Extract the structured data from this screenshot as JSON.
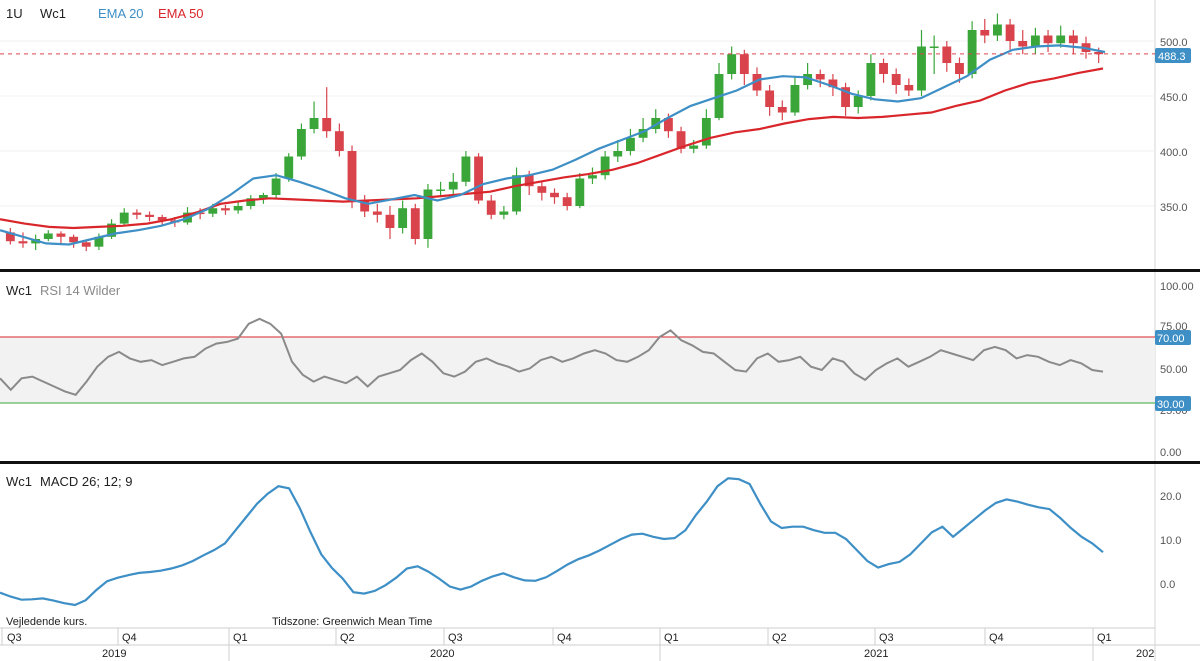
{
  "top_panel": {
    "interval": "1U",
    "symbol": "Wc1",
    "ema20_label": "EMA 20",
    "ema50_label": "EMA 50",
    "last_price": "488.3",
    "y_ticks": [
      "500.0",
      "450.0",
      "400.0",
      "350.0"
    ]
  },
  "rsi_panel": {
    "symbol": "Wc1",
    "label": "RSI 14 Wilder",
    "y_ticks": [
      "100.00",
      "75.00",
      "50.00",
      "25.00",
      "0.00"
    ],
    "upper_badge": "70.00",
    "lower_badge": "30.00"
  },
  "macd_panel": {
    "symbol": "Wc1",
    "label": "MACD 26; 12; 9",
    "y_ticks": [
      "20.0",
      "10.0",
      "0.0"
    ]
  },
  "footer": {
    "note": "Vejledende kurs.",
    "timezone": "Tidszone: Greenwich Mean Time",
    "quarters": [
      "Q3",
      "Q4",
      "Q1",
      "Q2",
      "Q3",
      "Q4",
      "Q1",
      "Q2",
      "Q3",
      "Q4",
      "Q1"
    ],
    "years": [
      "2019",
      "2020",
      "2021",
      "202"
    ]
  },
  "colors": {
    "ema20": "#3d8fc6",
    "ema50": "#d9262b",
    "up": "#3aa63a",
    "down": "#d9434b",
    "rsi": "#8a8a8a",
    "macd": "#3d8fc6",
    "badge": "#3d8fc6"
  },
  "chart_data": [
    {
      "type": "line",
      "panel": "price",
      "x_quarters": [
        "Q3 2019",
        "Q4 2019",
        "Q1 2020",
        "Q2 2020",
        "Q3 2020",
        "Q4 2020",
        "Q1 2021",
        "Q2 2021",
        "Q3 2021",
        "Q4 2021",
        "Q1 2022"
      ],
      "ylim": [
        310,
        525
      ],
      "last": 488.3,
      "ema20": [
        328,
        322,
        316,
        315,
        320,
        325,
        328,
        332,
        338,
        347,
        360,
        375,
        378,
        372,
        365,
        357,
        352,
        356,
        360,
        355,
        360,
        370,
        375,
        378,
        383,
        392,
        402,
        410,
        418,
        430,
        441,
        448,
        455,
        465,
        468,
        467,
        460,
        452,
        447,
        445,
        448,
        458,
        468,
        483,
        492,
        495,
        496,
        494,
        490
      ],
      "ema50": [
        338,
        334,
        331,
        330,
        331,
        332,
        334,
        338,
        344,
        352,
        355,
        357,
        356,
        355,
        354,
        355,
        356,
        357,
        359,
        361,
        363,
        368,
        372,
        376,
        379,
        383,
        389,
        397,
        405,
        412,
        417,
        420,
        425,
        429,
        431,
        430,
        431,
        433,
        435,
        441,
        446,
        455,
        462,
        466,
        471,
        475
      ],
      "candles": [
        [
          326,
          318,
          330,
          315
        ],
        [
          318,
          316,
          326,
          312
        ],
        [
          316,
          320,
          324,
          310
        ],
        [
          320,
          325,
          328,
          318
        ],
        [
          325,
          322,
          327,
          316
        ],
        [
          322,
          317,
          324,
          312
        ],
        [
          317,
          313,
          319,
          309
        ],
        [
          313,
          322,
          325,
          310
        ],
        [
          322,
          334,
          338,
          320
        ],
        [
          334,
          344,
          348,
          332
        ],
        [
          344,
          342,
          347,
          338
        ],
        [
          342,
          340,
          345,
          336
        ],
        [
          340,
          337,
          342,
          333
        ],
        [
          337,
          335,
          340,
          331
        ],
        [
          335,
          344,
          349,
          333
        ],
        [
          344,
          343,
          348,
          338
        ],
        [
          343,
          348,
          352,
          340
        ],
        [
          348,
          346,
          351,
          342
        ],
        [
          346,
          350,
          355,
          343
        ],
        [
          350,
          357,
          360,
          347
        ],
        [
          357,
          360,
          362,
          352
        ],
        [
          360,
          375,
          380,
          357
        ],
        [
          375,
          395,
          398,
          372
        ],
        [
          395,
          420,
          425,
          392
        ],
        [
          420,
          430,
          445,
          416
        ],
        [
          430,
          418,
          458,
          412
        ],
        [
          418,
          400,
          425,
          395
        ],
        [
          400,
          355,
          405,
          348
        ],
        [
          355,
          345,
          360,
          340
        ],
        [
          345,
          342,
          352,
          335
        ],
        [
          342,
          330,
          350,
          320
        ],
        [
          330,
          348,
          355,
          325
        ],
        [
          348,
          320,
          352,
          315
        ],
        [
          320,
          365,
          370,
          312
        ],
        [
          365,
          365,
          372,
          358
        ],
        [
          365,
          372,
          380,
          360
        ],
        [
          372,
          395,
          400,
          368
        ],
        [
          395,
          355,
          398,
          352
        ],
        [
          355,
          342,
          360,
          338
        ],
        [
          342,
          345,
          350,
          338
        ],
        [
          345,
          378,
          385,
          342
        ],
        [
          378,
          368,
          382,
          360
        ],
        [
          368,
          362,
          372,
          355
        ],
        [
          362,
          358,
          366,
          352
        ],
        [
          358,
          350,
          362,
          346
        ],
        [
          350,
          375,
          380,
          348
        ],
        [
          375,
          378,
          385,
          370
        ],
        [
          378,
          395,
          400,
          374
        ],
        [
          395,
          400,
          410,
          390
        ],
        [
          400,
          412,
          420,
          396
        ],
        [
          412,
          420,
          430,
          408
        ],
        [
          420,
          430,
          438,
          416
        ],
        [
          430,
          418,
          434,
          412
        ],
        [
          418,
          402,
          422,
          398
        ],
        [
          402,
          405,
          410,
          398
        ],
        [
          405,
          430,
          438,
          402
        ],
        [
          430,
          470,
          480,
          428
        ],
        [
          470,
          488,
          495,
          465
        ],
        [
          488,
          470,
          492,
          460
        ],
        [
          470,
          455,
          476,
          450
        ],
        [
          455,
          440,
          460,
          432
        ],
        [
          440,
          435,
          446,
          428
        ],
        [
          435,
          460,
          468,
          432
        ],
        [
          460,
          470,
          480,
          456
        ],
        [
          470,
          465,
          474,
          458
        ],
        [
          465,
          458,
          470,
          450
        ],
        [
          458,
          440,
          462,
          432
        ],
        [
          440,
          450,
          455,
          434
        ],
        [
          450,
          480,
          488,
          446
        ],
        [
          480,
          470,
          484,
          462
        ],
        [
          470,
          460,
          475,
          452
        ],
        [
          460,
          455,
          466,
          450
        ],
        [
          455,
          495,
          510,
          450
        ],
        [
          495,
          495,
          505,
          470
        ],
        [
          495,
          480,
          500,
          472
        ],
        [
          480,
          470,
          485,
          462
        ],
        [
          470,
          510,
          518,
          466
        ],
        [
          510,
          505,
          520,
          498
        ],
        [
          505,
          515,
          525,
          500
        ],
        [
          515,
          500,
          520,
          490
        ],
        [
          500,
          495,
          510,
          488
        ],
        [
          495,
          505,
          512,
          488
        ],
        [
          505,
          498,
          510,
          490
        ],
        [
          498,
          505,
          514,
          494
        ],
        [
          505,
          498,
          510,
          488
        ],
        [
          498,
          490,
          504,
          484
        ],
        [
          490,
          488,
          494,
          480
        ]
      ]
    },
    {
      "type": "line",
      "panel": "rsi",
      "title": "RSI 14 Wilder",
      "ylim": [
        0,
        100
      ],
      "levels": [
        70,
        30
      ],
      "values": [
        45,
        38,
        45,
        46,
        43,
        40,
        37,
        35,
        43,
        52,
        58,
        61,
        57,
        55,
        56,
        53,
        55,
        57,
        58,
        63,
        66,
        67,
        69,
        78,
        81,
        78,
        72,
        55,
        47,
        43,
        46,
        44,
        42,
        46,
        40,
        46,
        48,
        50,
        56,
        60,
        55,
        48,
        46,
        49,
        55,
        57,
        54,
        52,
        49,
        51,
        56,
        58,
        55,
        57,
        60,
        62,
        60,
        56,
        55,
        58,
        62,
        70,
        74,
        68,
        65,
        61,
        60,
        55,
        50,
        49,
        57,
        60,
        55,
        56,
        58,
        52,
        50,
        57,
        55,
        48,
        44,
        50,
        54,
        57,
        52,
        55,
        58,
        62,
        60,
        58,
        56,
        62,
        64,
        62,
        57,
        59,
        58,
        55,
        53,
        56,
        54,
        50,
        49
      ]
    },
    {
      "type": "line",
      "panel": "macd",
      "title": "MACD 26; 12; 9",
      "ylim": [
        -5,
        25
      ],
      "values": [
        -2.2,
        -3.1,
        -3.8,
        -3.7,
        -3.5,
        -4.0,
        -4.6,
        -5.0,
        -3.9,
        -1.6,
        0.4,
        1.2,
        1.8,
        2.3,
        2.5,
        2.8,
        3.3,
        4.0,
        5.0,
        6.3,
        7.5,
        9.0,
        12.0,
        15.0,
        18.0,
        20.3,
        22.0,
        21.5,
        17.0,
        11.5,
        6.5,
        3.4,
        1.0,
        -2.1,
        -2.4,
        -1.8,
        -0.5,
        1.2,
        3.3,
        3.8,
        2.6,
        1.0,
        -0.8,
        -1.5,
        -0.8,
        0.5,
        1.5,
        2.2,
        1.3,
        0.6,
        0.5,
        1.3,
        2.7,
        4.2,
        5.4,
        6.3,
        7.4,
        8.7,
        10.0,
        11.0,
        11.2,
        10.5,
        10.0,
        10.2,
        12.0,
        15.5,
        18.5,
        22.0,
        23.8,
        23.6,
        22.5,
        18.0,
        14.0,
        12.5,
        12.8,
        12.8,
        12.0,
        11.4,
        11.4,
        10.0,
        7.5,
        5.0,
        3.5,
        4.3,
        4.8,
        6.5,
        9.0,
        11.5,
        12.8,
        10.5,
        12.5,
        14.5,
        16.5,
        18.2,
        19.0,
        18.5,
        17.8,
        17.2,
        16.8,
        14.8,
        12.5,
        10.5,
        9.0,
        7.0
      ]
    }
  ]
}
